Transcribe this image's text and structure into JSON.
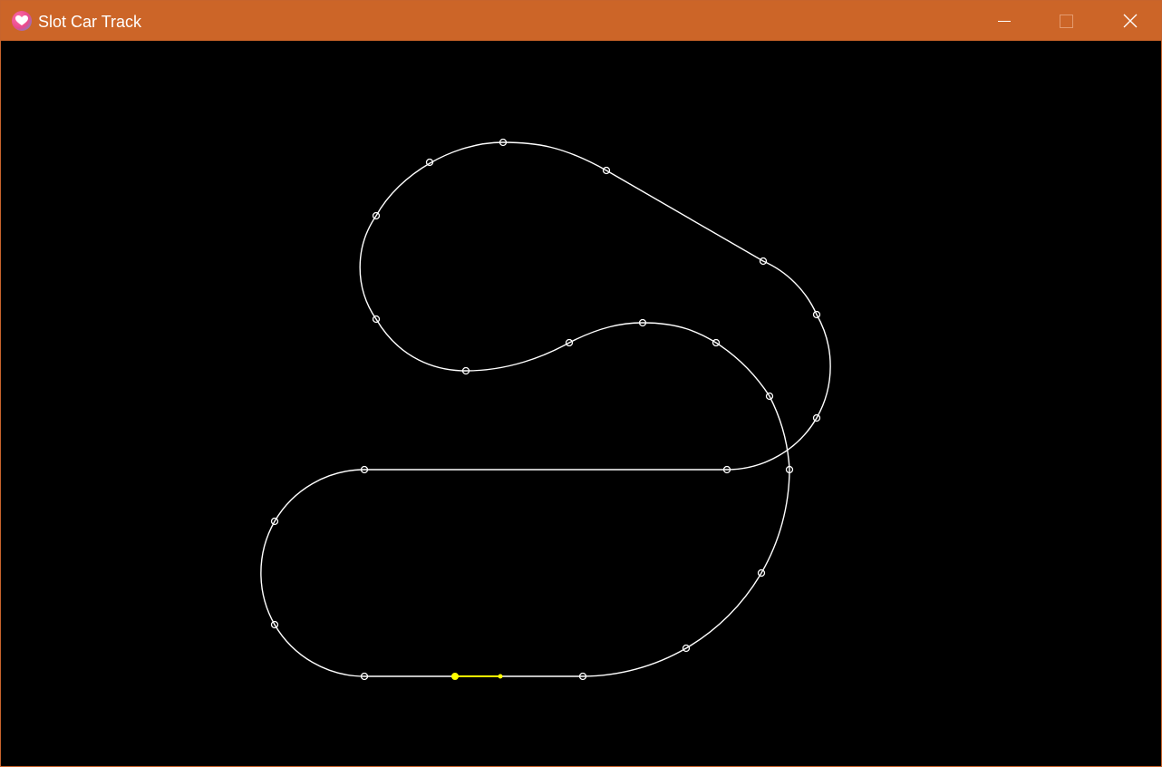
{
  "window": {
    "title": "Slot Car Track",
    "colors": {
      "titlebar": "#cc6528",
      "background": "#000000",
      "track": "#ffffff",
      "car": "#ffff00"
    }
  },
  "titlebar_buttons": {
    "minimize_icon": "minimize-icon",
    "maximize_icon": "maximize-icon",
    "close_icon": "close-icon"
  }
}
